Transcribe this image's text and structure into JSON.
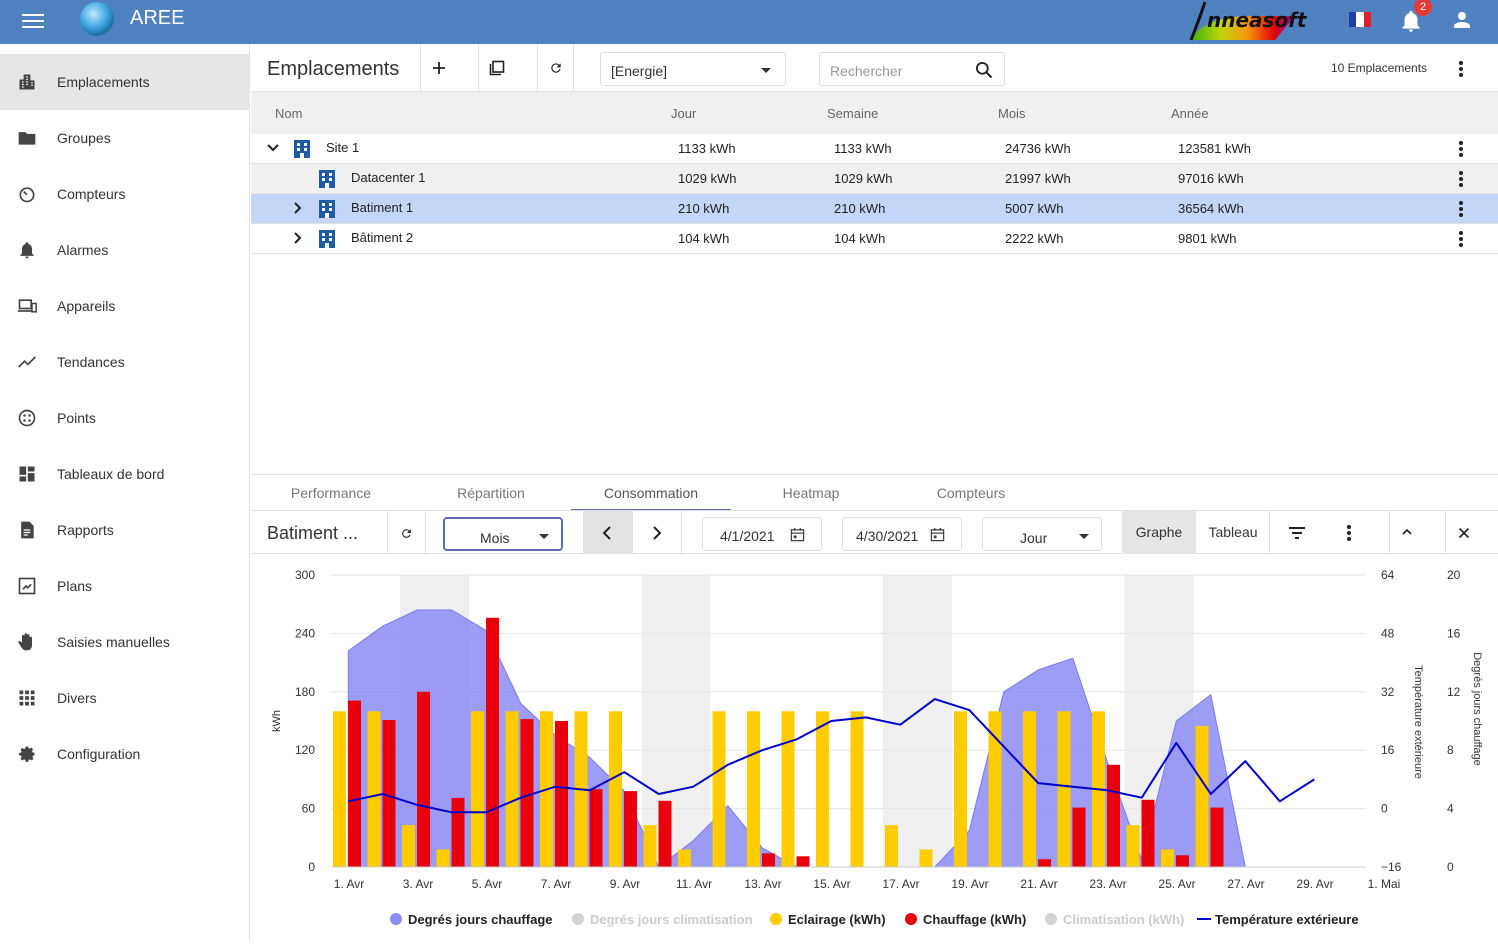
{
  "app": {
    "title": "AREE",
    "brand": "nneasoft",
    "notifications": "2"
  },
  "colors": {
    "topbar": "#5082c2",
    "building": "#1f5aa6",
    "selected_row": "#c4d5f7",
    "accent": "#5e6ab8"
  },
  "sidebar": {
    "items": [
      {
        "label": "Emplacements",
        "icon": "building-icon",
        "active": true
      },
      {
        "label": "Groupes",
        "icon": "folder-icon"
      },
      {
        "label": "Compteurs",
        "icon": "gauge-icon"
      },
      {
        "label": "Alarmes",
        "icon": "bell-icon"
      },
      {
        "label": "Appareils",
        "icon": "devices-icon"
      },
      {
        "label": "Tendances",
        "icon": "trend-icon"
      },
      {
        "label": "Points",
        "icon": "points-icon"
      },
      {
        "label": "Tableaux de bord",
        "icon": "dashboard-icon"
      },
      {
        "label": "Rapports",
        "icon": "report-icon"
      },
      {
        "label": "Plans",
        "icon": "plan-icon"
      },
      {
        "label": "Saisies manuelles",
        "icon": "hand-icon"
      },
      {
        "label": "Divers",
        "icon": "apps-icon"
      },
      {
        "label": "Configuration",
        "icon": "gear-icon"
      }
    ]
  },
  "header": {
    "title": "Emplacements",
    "filter": "[Energie]",
    "search_placeholder": "Rechercher",
    "count": "10 Emplacements"
  },
  "table": {
    "columns": [
      "Nom",
      "Jour",
      "Semaine",
      "Mois",
      "Année"
    ],
    "rows": [
      {
        "name": "Site 1",
        "jour": "1133 kWh",
        "semaine": "1133 kWh",
        "mois": "24736 kWh",
        "annee": "123581 kWh"
      },
      {
        "name": "Datacenter 1",
        "jour": "1029 kWh",
        "semaine": "1029 kWh",
        "mois": "21997 kWh",
        "annee": "97016 kWh"
      },
      {
        "name": "Batiment 1",
        "jour": "210 kWh",
        "semaine": "210 kWh",
        "mois": "5007 kWh",
        "annee": "36564 kWh"
      },
      {
        "name": "Bâtiment 2",
        "jour": "104 kWh",
        "semaine": "104 kWh",
        "mois": "2222 kWh",
        "annee": "9801 kWh"
      }
    ]
  },
  "tabs": [
    "Performance",
    "Répartition",
    "Consommation",
    "Heatmap",
    "Compteurs"
  ],
  "chart_toolbar": {
    "title": "Batiment ...",
    "period": "Mois",
    "date_from": "4/1/2021",
    "date_to": "4/30/2021",
    "granularity": "Jour",
    "view_graph": "Graphe",
    "view_table": "Tableau"
  },
  "chart_data": {
    "type": "bar",
    "ylabel": "kWh",
    "y2label": "Température extérieure",
    "y3label": "Degrés jours chauffage",
    "ylim": [
      0,
      300
    ],
    "y2lim": [
      -16,
      64
    ],
    "y3lim": [
      0,
      20
    ],
    "yticks": [
      0,
      60,
      120,
      180,
      240,
      300
    ],
    "y2ticks": [
      -16,
      0,
      16,
      32,
      48,
      64
    ],
    "y3ticks": [
      0,
      4,
      8,
      12,
      16,
      20
    ],
    "x_tick_labels": [
      "1. Avr",
      "3. Avr",
      "5. Avr",
      "7. Avr",
      "9. Avr",
      "11. Avr",
      "13. Avr",
      "15. Avr",
      "17. Avr",
      "19. Avr",
      "21. Avr",
      "23. Avr",
      "25. Avr",
      "27. Avr",
      "29. Avr",
      "1. Mai"
    ],
    "days": 30,
    "weekend_start_days": [
      3,
      10,
      17,
      24
    ],
    "series": [
      {
        "name": "Degrés jours chauffage",
        "type": "area",
        "color": "#8c8cf5",
        "values": [
          14.8,
          16.5,
          17.6,
          17.6,
          16.2,
          11.2,
          9.0,
          7.5,
          5.2,
          0,
          1.8,
          4.2,
          1.3,
          0,
          0,
          0,
          0,
          0,
          2.5,
          12.0,
          13.5,
          14.3,
          7.2,
          0.5,
          10.0,
          11.8,
          0,
          0,
          0,
          0
        ]
      },
      {
        "name": "Degrés jours climatisation",
        "type": "area",
        "color": "#d3d3d3",
        "disabled": true,
        "values": []
      },
      {
        "name": "Eclairage (kWh)",
        "type": "bar",
        "color": "#ffcc00",
        "values": [
          160,
          160,
          43,
          18,
          160,
          160,
          160,
          160,
          160,
          43,
          18,
          160,
          160,
          160,
          160,
          160,
          43,
          18,
          160,
          160,
          160,
          160,
          160,
          43,
          18,
          145,
          0,
          0,
          0,
          0
        ]
      },
      {
        "name": "Chauffage (kWh)",
        "type": "bar",
        "color": "#e8000b",
        "values": [
          171,
          151,
          180,
          71,
          256,
          152,
          150,
          80,
          78,
          68,
          0,
          0,
          14,
          11,
          0,
          0,
          0,
          0,
          0,
          0,
          8,
          61,
          105,
          69,
          12,
          61,
          0,
          0,
          0,
          0
        ]
      },
      {
        "name": "Climatisation (kWh)",
        "type": "bar",
        "color": "#d3d3d3",
        "disabled": true,
        "values": []
      },
      {
        "name": "Température extérieure",
        "type": "line",
        "color": "#0000cc",
        "values": [
          2,
          4,
          1,
          -1,
          -1,
          3,
          6,
          5,
          10,
          4,
          6,
          12,
          16,
          19,
          24,
          25,
          23,
          30,
          27,
          17,
          7,
          6,
          5,
          3,
          18,
          4,
          13,
          2,
          8
        ]
      }
    ],
    "legend_position": "bottom"
  }
}
